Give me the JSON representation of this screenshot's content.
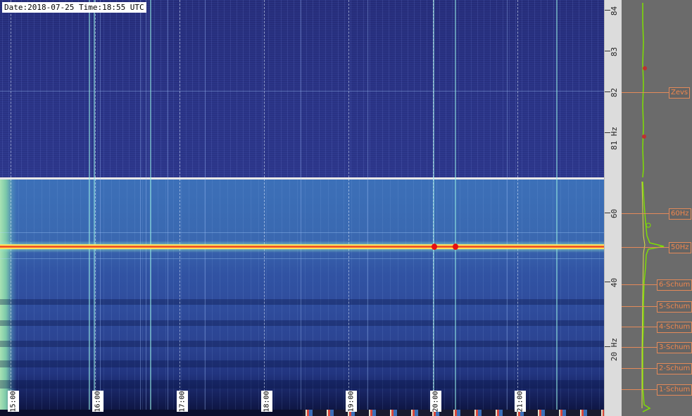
{
  "header": {
    "date_time": "Date:2018-07-25 Time:18:55 UTC"
  },
  "time_axis": {
    "labels": [
      "15:00",
      "16:00",
      "17:00",
      "18:00",
      "19:00",
      "20:00",
      "21:00"
    ]
  },
  "freq_axis": {
    "top_labels": [
      "84",
      "83",
      "82",
      "81 Hz"
    ],
    "bottom_labels": [
      "60",
      "40",
      "20 Hz"
    ]
  },
  "markers": {
    "zevs": "Zevs",
    "hz60": "60Hz",
    "hz50": "50Hz",
    "schum6": "6-Schum",
    "schum5": "5-Schum",
    "schum4": "4-Schum",
    "schum3": "3-Schum",
    "schum2": "2-Schum",
    "schum1": "1-Schum"
  },
  "colors": {
    "marker": "#e48a5a",
    "profile_line": "#7ee000",
    "powerline": "#e8161a"
  }
}
